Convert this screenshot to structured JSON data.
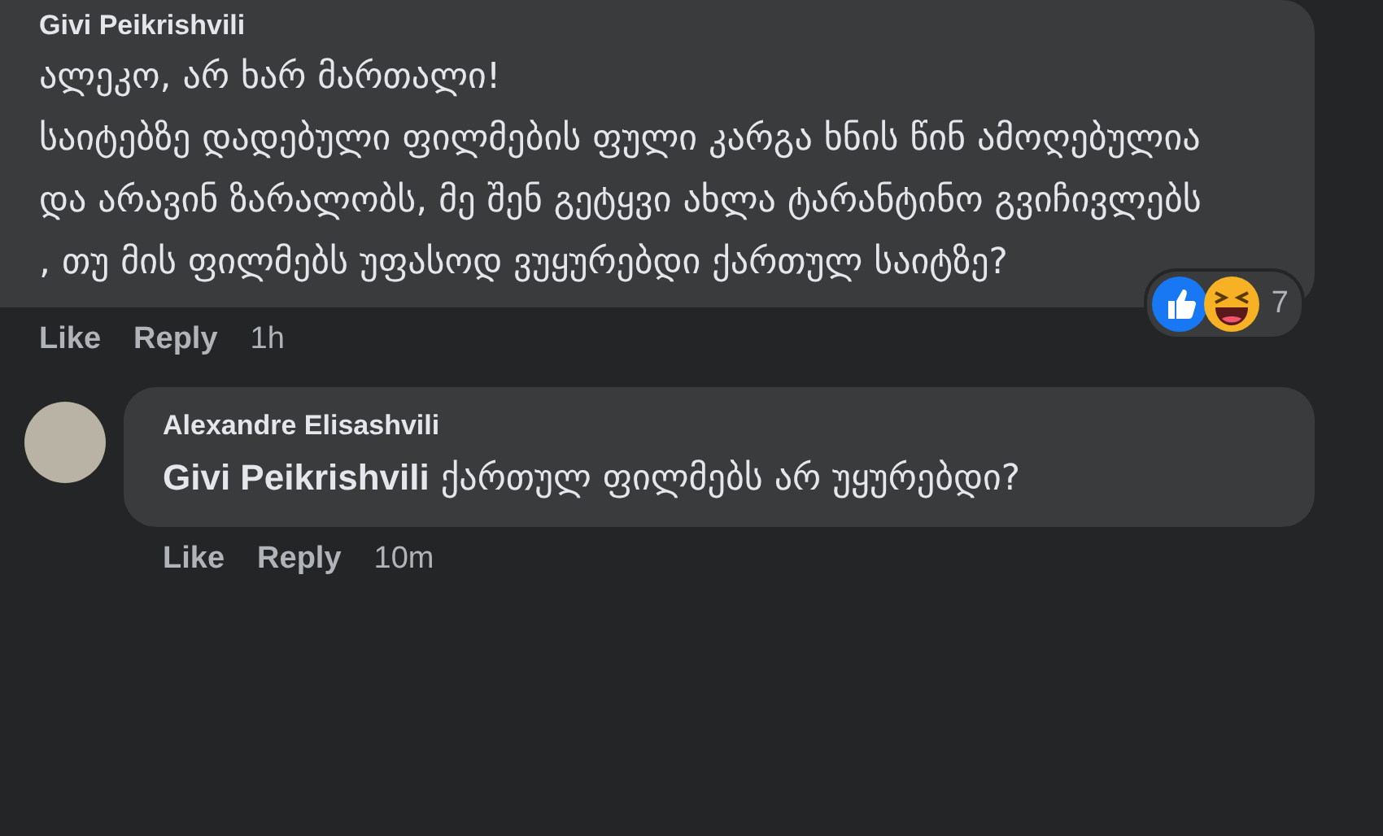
{
  "comments": [
    {
      "author": "Givi Peikrishvili",
      "paragraphs": [
        "ალეკო, არ ხარ მართალი!",
        "საიტებზე დადებული ფილმების ფული კარგა ხნის წინ ამოღებულია და არავინ ზარალობს, მე შენ გეტყვი ახლა ტარანტინო გვიჩივლებს , თუ მის ფილმებს უფასოდ ვუყურებდი ქართულ საიტზე?"
      ],
      "reactions": {
        "count": "7"
      },
      "actions": [
        "Like",
        "Reply"
      ],
      "time": "1h"
    },
    {
      "author": "Alexandre Elisashvili",
      "avatar": true,
      "paragraphs": [
        "**Givi Peikrishvili** ქართულ ფილმებს არ უყურებდი?"
      ],
      "actions": [
        "Like",
        "Reply"
      ],
      "time": "10m"
    }
  ]
}
